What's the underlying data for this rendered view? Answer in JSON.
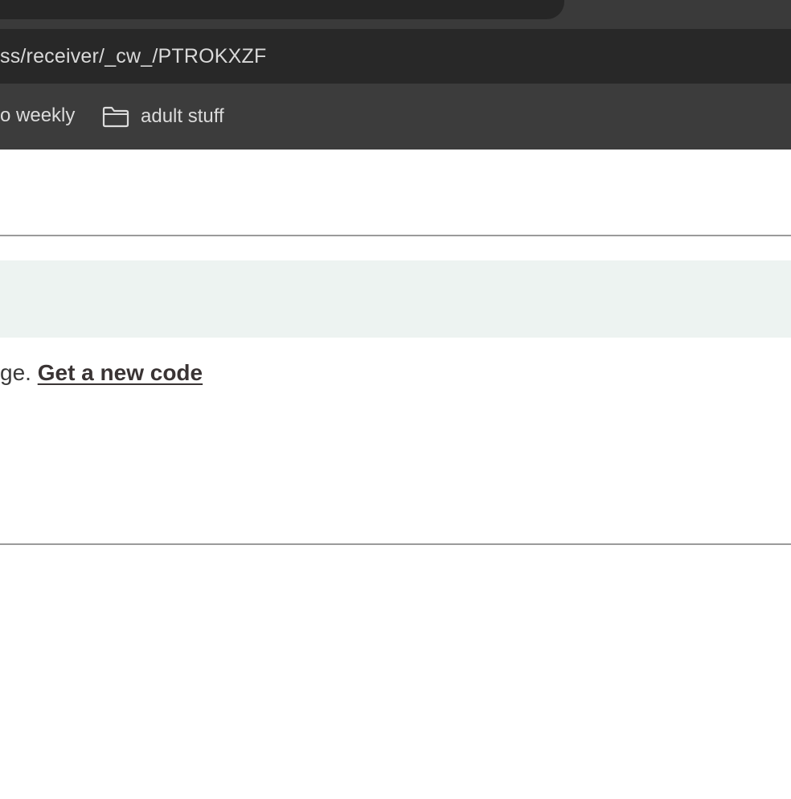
{
  "browser": {
    "address_bar": {
      "url_text": "ss/receiver/_cw_/PTROKXZF"
    },
    "bookmarks": [
      {
        "label": "o weekly",
        "icon": "none"
      },
      {
        "label": "adult stuff",
        "icon": "folder-icon"
      }
    ]
  },
  "page": {
    "message_prefix": "ge.",
    "new_code_link": "Get a new code"
  },
  "colors": {
    "tab_strip": "#3a3a3a",
    "address_bar": "#282828",
    "bookmarks_bar": "#3c3c3c",
    "notice_band": "#edf3f1",
    "divider": "#9a9a9a"
  }
}
